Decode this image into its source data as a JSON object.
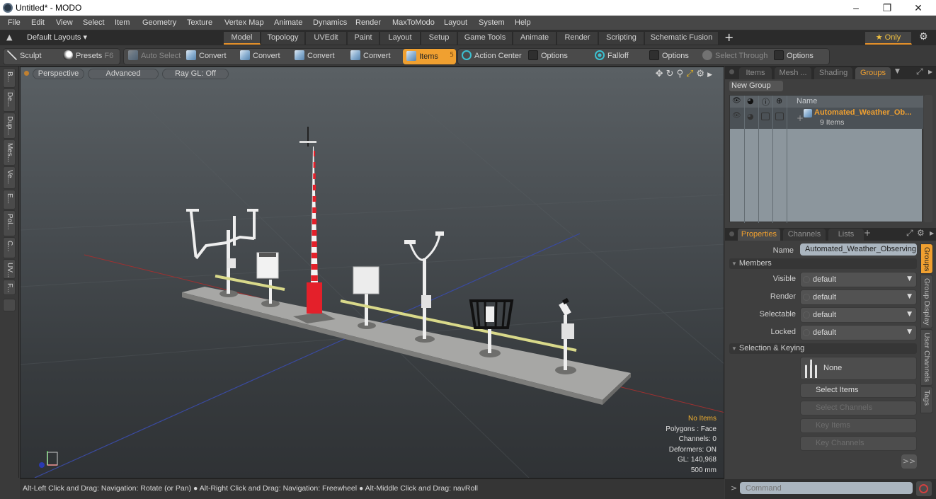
{
  "window": {
    "title": "Untitled* - MODO",
    "minimize": "–",
    "restore": "❐",
    "close": "✕"
  },
  "menu": [
    "File",
    "Edit",
    "View",
    "Select",
    "Item",
    "Geometry",
    "Texture",
    "Vertex Map",
    "Animate",
    "Dynamics",
    "Render",
    "MaxToModo",
    "Layout",
    "System",
    "Help"
  ],
  "layoutbar": {
    "default_layouts": "Default Layouts ▾",
    "tabs": [
      "Model",
      "Topology",
      "UVEdit",
      "Paint",
      "Layout",
      "Setup",
      "Game Tools",
      "Animate",
      "Render",
      "Scripting",
      "Schematic Fusion"
    ],
    "active_tab": "Model",
    "add": "+",
    "only": "★ Only",
    "gear": "⚙"
  },
  "toolbar": {
    "sculpt": "Sculpt",
    "presets": "Presets",
    "presets_key": "F6",
    "auto_select": "Auto Select",
    "convert1": "Convert",
    "convert2": "Convert",
    "convert3": "Convert",
    "convert4": "Convert",
    "items": "Items",
    "items_key": "5",
    "action_center": "Action Center",
    "options1": "Options",
    "falloff": "Falloff",
    "options2": "Options",
    "select_through": "Select Through",
    "options3": "Options"
  },
  "left_tabs": [
    "B...",
    "De...",
    "Dup...",
    "Mes...",
    "Ve...",
    "E...",
    "Pol...",
    "C...",
    "UV...",
    "F..."
  ],
  "viewport": {
    "perspective": "Perspective",
    "advanced": "Advanced",
    "raygl": "Ray GL: Off",
    "info": {
      "items": "No Items",
      "polygons": "Polygons : Face",
      "channels": "Channels: 0",
      "deformers": "Deformers: ON",
      "gl": "GL: 140,968",
      "scale": "500 mm"
    }
  },
  "status": "Alt-Left Click and Drag: Navigation: Rotate (or Pan) ● Alt-Right Click and Drag: Navigation: Freewheel ● Alt-Middle Click and Drag: navRoll",
  "groups_panel": {
    "tabs": [
      "Items",
      "Mesh ...",
      "Shading",
      "Groups"
    ],
    "active_tab": "Groups",
    "new_group": "New Group",
    "col_name": "Name",
    "group_name": "Automated_Weather_Ob...",
    "group_count": "9 Items"
  },
  "properties_panel": {
    "tabs": [
      "Properties",
      "Channels",
      "Lists"
    ],
    "active_tab": "Properties",
    "add": "+",
    "name_label": "Name",
    "name_value": "Automated_Weather_Observing",
    "members_section": "Members",
    "rows": [
      {
        "label": "Visible",
        "value": "default"
      },
      {
        "label": "Render",
        "value": "default"
      },
      {
        "label": "Selectable",
        "value": "default"
      },
      {
        "label": "Locked",
        "value": "default"
      }
    ],
    "selection_section": "Selection & Keying",
    "none_label": "None",
    "select_items": "Select Items",
    "select_channels": "Select Channels",
    "key_items": "Key Items",
    "key_channels": "Key Channels",
    "more": ">>",
    "side_tabs": [
      "Groups",
      "Group Display",
      "User Channels",
      "Tags"
    ],
    "active_side_tab": "Groups"
  },
  "command": {
    "prompt": ">",
    "placeholder": "Command"
  },
  "colors": {
    "accent": "#f0a030",
    "panel": "#3f3f3f",
    "list_bg": "#8c969d"
  }
}
